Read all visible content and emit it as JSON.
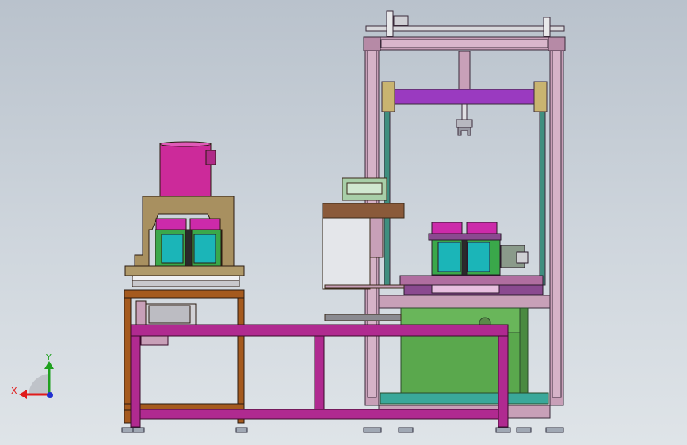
{
  "triad": {
    "x_label": "X",
    "y_label": "Y",
    "x_color": "#e01b1b",
    "y_color": "#1fa01f",
    "z_color": "#2030d0"
  },
  "colors": {
    "background": "#c6ced6",
    "frame_pink": "#c8a0b8",
    "frame_magenta": "#b02a90",
    "frame_brown": "#a55a1e",
    "motor_magenta": "#cc2a9a",
    "cabinet_green": "#69b65a",
    "tank_cyan": "#1bb5b8",
    "beam_purple": "#9a3ac0",
    "housing_olive": "#a89060"
  }
}
